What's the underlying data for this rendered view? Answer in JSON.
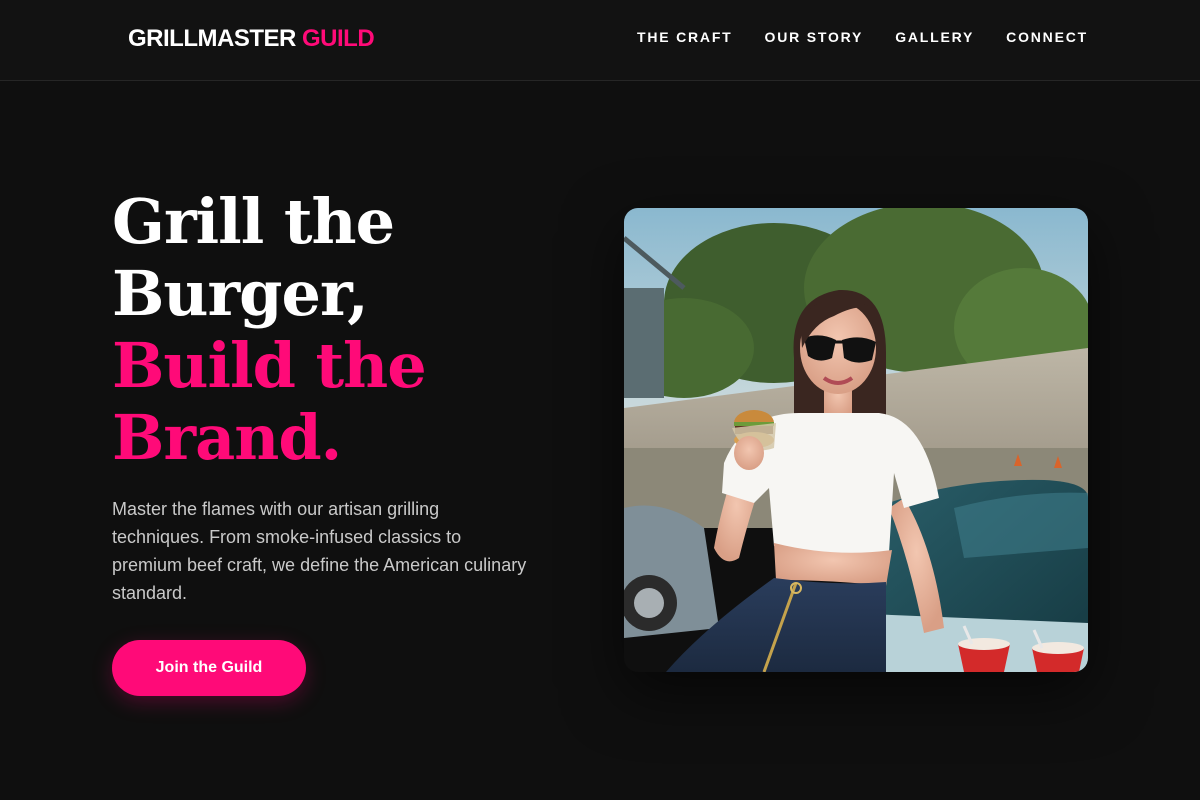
{
  "colors": {
    "accent": "#ff0a78",
    "background": "#0f0f0f"
  },
  "header": {
    "logo_main": "GRILLMASTER",
    "logo_accent": "GUILD",
    "nav": [
      {
        "label": "THE CRAFT"
      },
      {
        "label": "OUR STORY"
      },
      {
        "label": "GALLERY"
      },
      {
        "label": "CONNECT"
      }
    ]
  },
  "hero": {
    "title_line1": "Grill the",
    "title_line2": "Burger,",
    "title_line3": "Build the",
    "title_line4": "Brand.",
    "description": "Master the flames with our artisan grilling techniques. From smoke-infused classics to premium beef craft, we define the American culinary standard.",
    "cta_label": "Join the Guild"
  },
  "photo": {
    "subject": "woman in sunglasses holding a burger by a car"
  }
}
